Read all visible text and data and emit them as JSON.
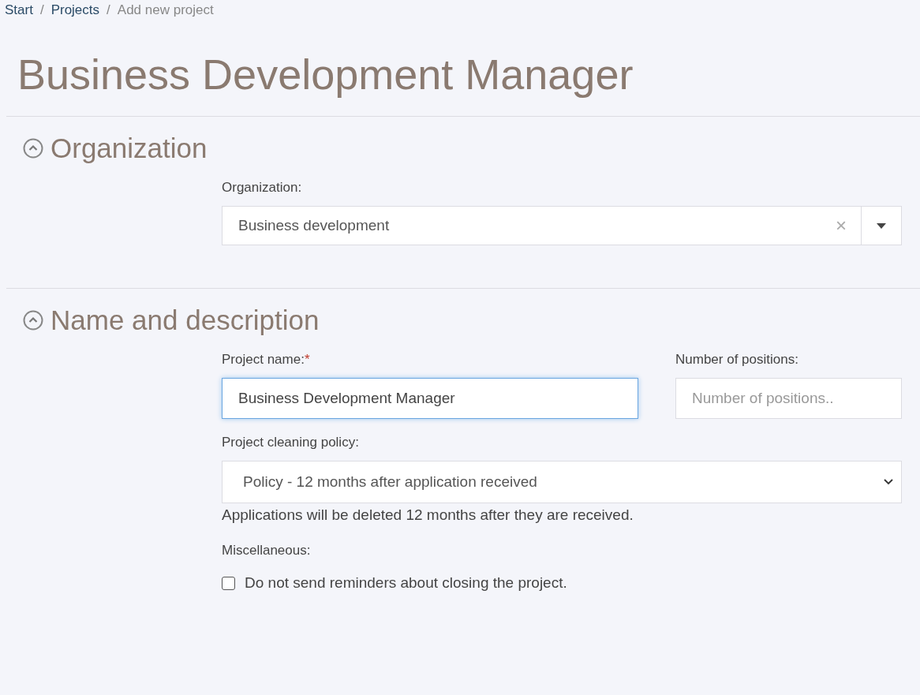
{
  "breadcrumb": [
    {
      "label": "Start",
      "link": true
    },
    {
      "label": "/",
      "link": false
    },
    {
      "label": "Projects",
      "link": true
    },
    {
      "label": "/",
      "link": false
    },
    {
      "label": "Add new project",
      "link": false
    }
  ],
  "title": "Business Development Manager",
  "sections": [
    {
      "title": "Organization",
      "expanded": true,
      "kind": "organization",
      "label": "Organization:",
      "value": "Business development",
      "clear": "×"
    },
    {
      "title": "Name and description",
      "expanded": true,
      "kind": "name",
      "name_label": "Project name:",
      "required_mark": "*",
      "name_value": "Business Development Manager",
      "name_focused": true,
      "positions_label": "Number of positions:",
      "positions_placeholder": "Number of positions..",
      "policy_label": "Project cleaning policy:",
      "policy_value": "Policy - 12 months after application received",
      "policy_help": "Applications will be deleted 12 months after they are received.",
      "misc_label": "Miscellaneous:",
      "checkbox": {
        "label": "Do not send reminders about closing the project.",
        "checked": false
      }
    }
  ]
}
